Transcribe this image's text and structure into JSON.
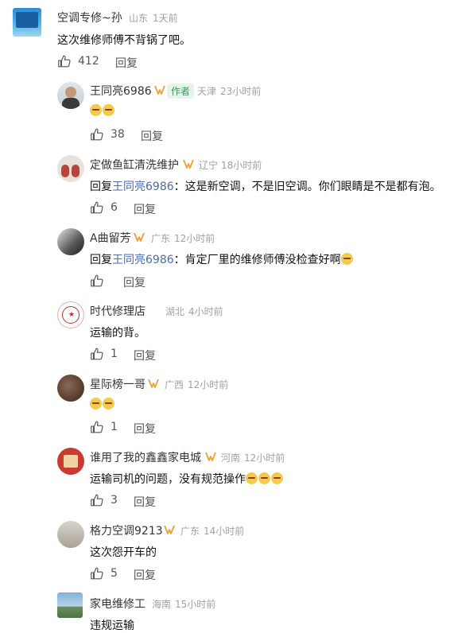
{
  "comments": [
    {
      "name": "空调专修~孙",
      "location": "山东",
      "time": "1天前",
      "text": "这次维修师傅不背锅了吧。",
      "likes": "412",
      "reply": "回复"
    },
    {
      "name": "王同亮6986",
      "badge": "作者",
      "location": "天津",
      "time": "23小时前",
      "text": "",
      "likes": "38",
      "reply": "回复"
    },
    {
      "name": "定做鱼缸清洗维护",
      "location": "辽宁",
      "time": "18小时前",
      "reply_prefix": "回复",
      "reply_target": "王同亮6986",
      "text": "：这是新空调，不是旧空调。你们眼睛是不是都有泡。",
      "likes": "6",
      "reply": "回复"
    },
    {
      "name": "A曲留芳",
      "location": "广东",
      "time": "12小时前",
      "reply_prefix": "回复",
      "reply_target": "王同亮6986",
      "text": "：肯定厂里的维修师傅没检查好啊",
      "likes": "",
      "reply": "回复"
    },
    {
      "name": "时代修理店",
      "location": "湖北",
      "time": "4小时前",
      "text": "运输的背。",
      "likes": "1",
      "reply": "回复"
    },
    {
      "name": "星际榜一哥",
      "location": "广西",
      "time": "12小时前",
      "text": "",
      "likes": "1",
      "reply": "回复"
    },
    {
      "name": "谁用了我的鑫鑫家电城",
      "location": "河南",
      "time": "12小时前",
      "text": "运输司机的问题，没有规范操作",
      "likes": "3",
      "reply": "回复"
    },
    {
      "name": "格力空调9213",
      "location": "广东",
      "time": "14小时前",
      "text": "这次怨开车的",
      "likes": "5",
      "reply": "回复"
    },
    {
      "name": "家电维修工",
      "location": "海南",
      "time": "15小时前",
      "text": "违规运输"
    }
  ],
  "colors": {
    "accent_v": "#f0a030",
    "link": "#4a6da7",
    "author_badge": "#2e9f5a"
  }
}
